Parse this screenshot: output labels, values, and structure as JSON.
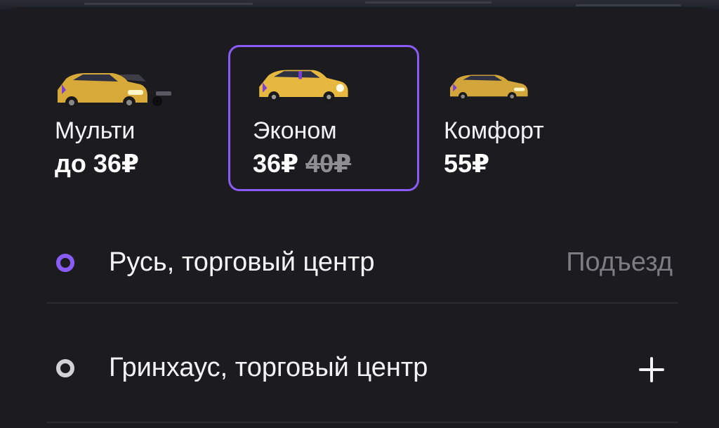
{
  "colors": {
    "background": "#1c1b20",
    "accent": "#8a5cf6",
    "text_primary": "#f4f4f6",
    "text_muted": "#7c7c82",
    "car_yellow": "#e0b23f"
  },
  "tariffs": [
    {
      "name": "Мульти",
      "price": "до 36₽",
      "icon": "multi-cars-icon",
      "selected": false
    },
    {
      "name": "Эконом",
      "price": "36₽",
      "old_price": "40₽",
      "icon": "economy-car-icon",
      "selected": true
    },
    {
      "name": "Комфорт",
      "price": "55₽",
      "icon": "comfort-car-icon",
      "selected": false
    }
  ],
  "route": {
    "from": {
      "label": "Русь, торговый центр",
      "action": "Подъезд",
      "icon": "origin-dot-icon"
    },
    "to": {
      "label": "Гринхаус, торговый центр",
      "action_icon": "plus-icon",
      "icon": "destination-dot-icon"
    }
  }
}
